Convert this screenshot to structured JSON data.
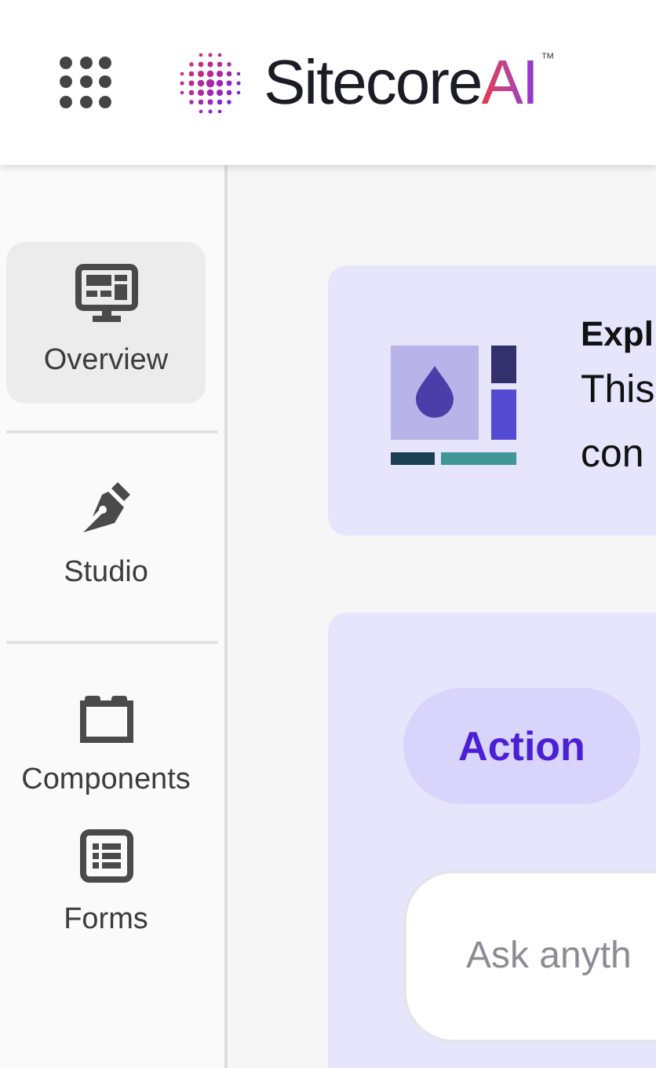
{
  "header": {
    "logo": {
      "text": "Sitecore",
      "accent": "AI",
      "trademark": "™"
    }
  },
  "sidebar": {
    "items": [
      {
        "label": "Overview",
        "kind": "monitor",
        "selected": true
      },
      {
        "label": "Studio",
        "kind": "pen",
        "selected": false
      },
      {
        "label": "Components",
        "kind": "blocks",
        "selected": false
      },
      {
        "label": "Forms",
        "kind": "form",
        "selected": false
      }
    ]
  },
  "banner": {
    "title": "Expl",
    "lines": [
      "This",
      "con"
    ]
  },
  "assistant": {
    "chip": "Action",
    "input": {
      "placeholder": "Ask anyth"
    }
  }
}
